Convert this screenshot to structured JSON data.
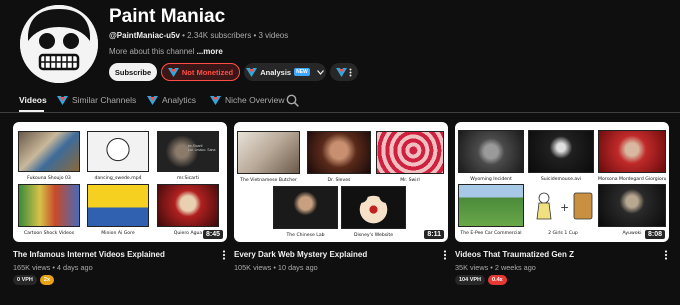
{
  "channel": {
    "title": "Paint Maniac",
    "handle": "@PaintManiac-u5v",
    "stats": " • 2.34K subscribers • 3 videos",
    "about": "More about this channel",
    "about_more": " ...more"
  },
  "buttons": {
    "subscribe": "Subscribe",
    "monetization": "Not Monetized",
    "analysis": "Analysis",
    "analysis_badge": "NEW",
    "dropdown_icon": "chevron-down-icon",
    "more_icon": "vertical-dots-icon"
  },
  "tabs": {
    "videos": "Videos",
    "similar": "Similar Channels",
    "analytics": "Analytics",
    "niche": "Niche Overview",
    "search_icon": "search-icon"
  },
  "videos": [
    {
      "title": "The Infamous Internet Videos Explained",
      "meta": "165K views • 4 days ago",
      "duration": "8:45",
      "vph": "0 VPH",
      "multiplier": "2x",
      "multiplier_color": "#e8a317",
      "tiles": [
        "Fukouna Shoujo 03",
        "dancing_swede.mp4",
        "mr.Sicarti",
        "Cartoon Shock Videos",
        "Minion Ai Gore",
        "Quiero Agua"
      ],
      "tile_texts": [
        "ex.Sicarti",
        "Lol. Lmaoo. Sana"
      ]
    },
    {
      "title": "Every Dark Web Mystery Explained",
      "meta": "105K views • 10 days ago",
      "duration": "8:11",
      "vph": "",
      "multiplier": "",
      "multiplier_color": "",
      "tiles": [
        "The Vietnamese Butcher",
        "Dr. Sleves",
        "Mr. Swirl",
        "The Chinese Lab",
        "Disney's Website"
      ],
      "tile_texts": []
    },
    {
      "title": "Videos That Traumatized Gen Z",
      "meta": "35K views • 2 weeks ago",
      "duration": "8:08",
      "vph": "104 VPH",
      "multiplier": "0.4x",
      "multiplier_color": "#e53935",
      "tiles": [
        "Wyoming Incident",
        "Suicidemouse.avi",
        "Morsona Mordegard Giorgioru",
        "The E-Pee Car Commercial",
        "2 Girls 1 Cup",
        "Ayuwoki"
      ],
      "tile_texts": []
    }
  ],
  "colors": {
    "background": "#0f0f0f",
    "accent_red": "#ff4e45",
    "vidiq_blue": "#2ea8e0"
  }
}
